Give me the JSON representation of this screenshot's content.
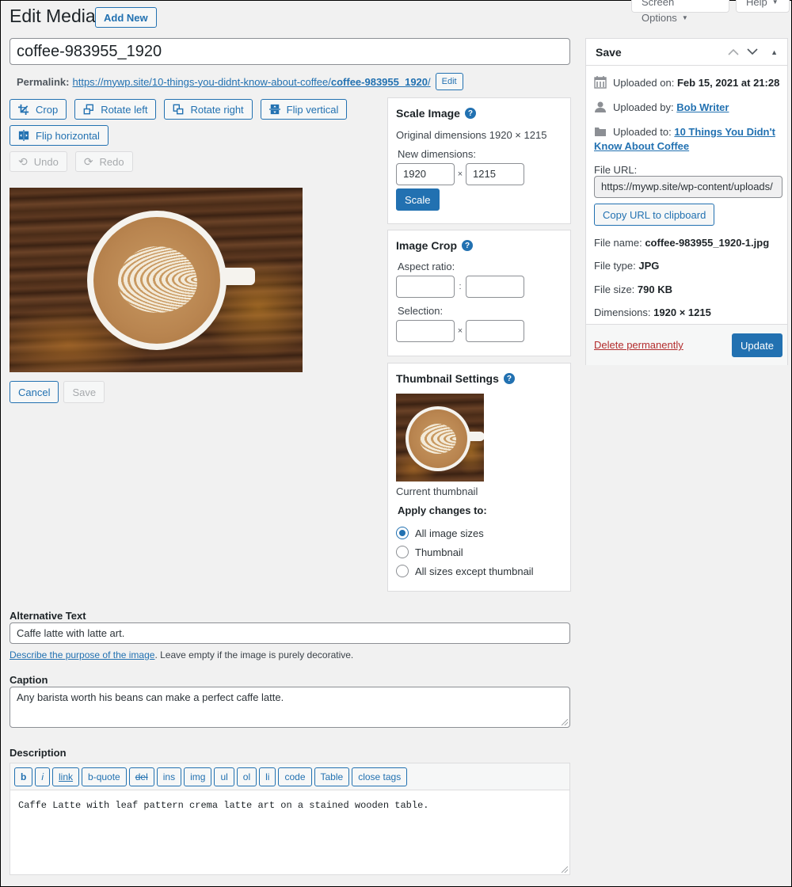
{
  "screen_meta": {
    "screen_options_label": "Screen Options",
    "help_label": "Help"
  },
  "header": {
    "title": "Edit Media",
    "add_new_label": "Add New"
  },
  "post": {
    "title_value": "coffee-983955_1920",
    "permalink_label": "Permalink:",
    "permalink_base": "https://mywp.site/10-things-you-didnt-know-about-coffee/",
    "permalink_slug": "coffee-983955_1920",
    "permalink_trail": "/",
    "edit_slug_label": "Edit"
  },
  "image_editor": {
    "tools": [
      {
        "id": "crop",
        "label": "Crop",
        "icon": "crop-icon"
      },
      {
        "id": "rotate-left",
        "label": "Rotate left",
        "icon": "rotate-left-icon"
      },
      {
        "id": "rotate-right",
        "label": "Rotate right",
        "icon": "rotate-right-icon"
      },
      {
        "id": "flip-vertical",
        "label": "Flip vertical",
        "icon": "flip-vertical-icon"
      },
      {
        "id": "flip-horizontal",
        "label": "Flip horizontal",
        "icon": "flip-horizontal-icon"
      }
    ],
    "undo_label": "Undo",
    "redo_label": "Redo",
    "cancel_label": "Cancel",
    "save_label": "Save"
  },
  "scale_image": {
    "title": "Scale Image",
    "original_label": "Original dimensions 1920 × 1215",
    "new_dimensions_label": "New dimensions:",
    "width_value": "1920",
    "height_value": "1215",
    "separator": "×",
    "scale_button_label": "Scale"
  },
  "image_crop": {
    "title": "Image Crop",
    "aspect_ratio_label": "Aspect ratio:",
    "aspect_separator": ":",
    "selection_label": "Selection:",
    "selection_separator": "×",
    "aspect_w": "",
    "aspect_h": "",
    "sel_w": "",
    "sel_h": ""
  },
  "thumbnail_settings": {
    "title": "Thumbnail Settings",
    "current_thumbnail_label": "Current thumbnail",
    "apply_label": "Apply changes to:",
    "options": [
      {
        "label": "All image sizes",
        "checked": true
      },
      {
        "label": "Thumbnail",
        "checked": false
      },
      {
        "label": "All sizes except thumbnail",
        "checked": false
      }
    ]
  },
  "save_box": {
    "title": "Save",
    "uploaded_on_label": "Uploaded on:",
    "uploaded_on_value": "Feb 15, 2021 at 21:28",
    "uploaded_by_label": "Uploaded by:",
    "uploaded_by_value": "Bob Writer",
    "uploaded_to_label": "Uploaded to:",
    "uploaded_to_value_line1": "10 Things You Didn't",
    "uploaded_to_value_line2": "Know About Coffee",
    "file_url_label": "File URL:",
    "file_url_value": "https://mywp.site/wp-content/uploads/",
    "copy_url_label": "Copy URL to clipboard",
    "file_name_label": "File name:",
    "file_name_value": "coffee-983955_1920-1.jpg",
    "file_type_label": "File type:",
    "file_type_value": "JPG",
    "file_size_label": "File size:",
    "file_size_value": "790 KB",
    "dimensions_label": "Dimensions:",
    "dimensions_value": "1920 × 1215",
    "delete_label": "Delete permanently",
    "update_label": "Update"
  },
  "fields": {
    "alt_label": "Alternative Text",
    "alt_value": "Caffe latte with latte art.",
    "alt_help_link": "Describe the purpose of the image",
    "alt_help_text": ". Leave empty if the image is purely decorative.",
    "caption_label": "Caption",
    "caption_value": "Any barista worth his beans can make a perfect caffe latte.",
    "description_label": "Description",
    "description_value": "Caffe Latte with leaf pattern crema latte art on a stained wooden table.",
    "quicktags": [
      "b",
      "i",
      "link",
      "b-quote",
      "del",
      "ins",
      "img",
      "ul",
      "ol",
      "li",
      "code",
      "Table",
      "close tags"
    ]
  }
}
